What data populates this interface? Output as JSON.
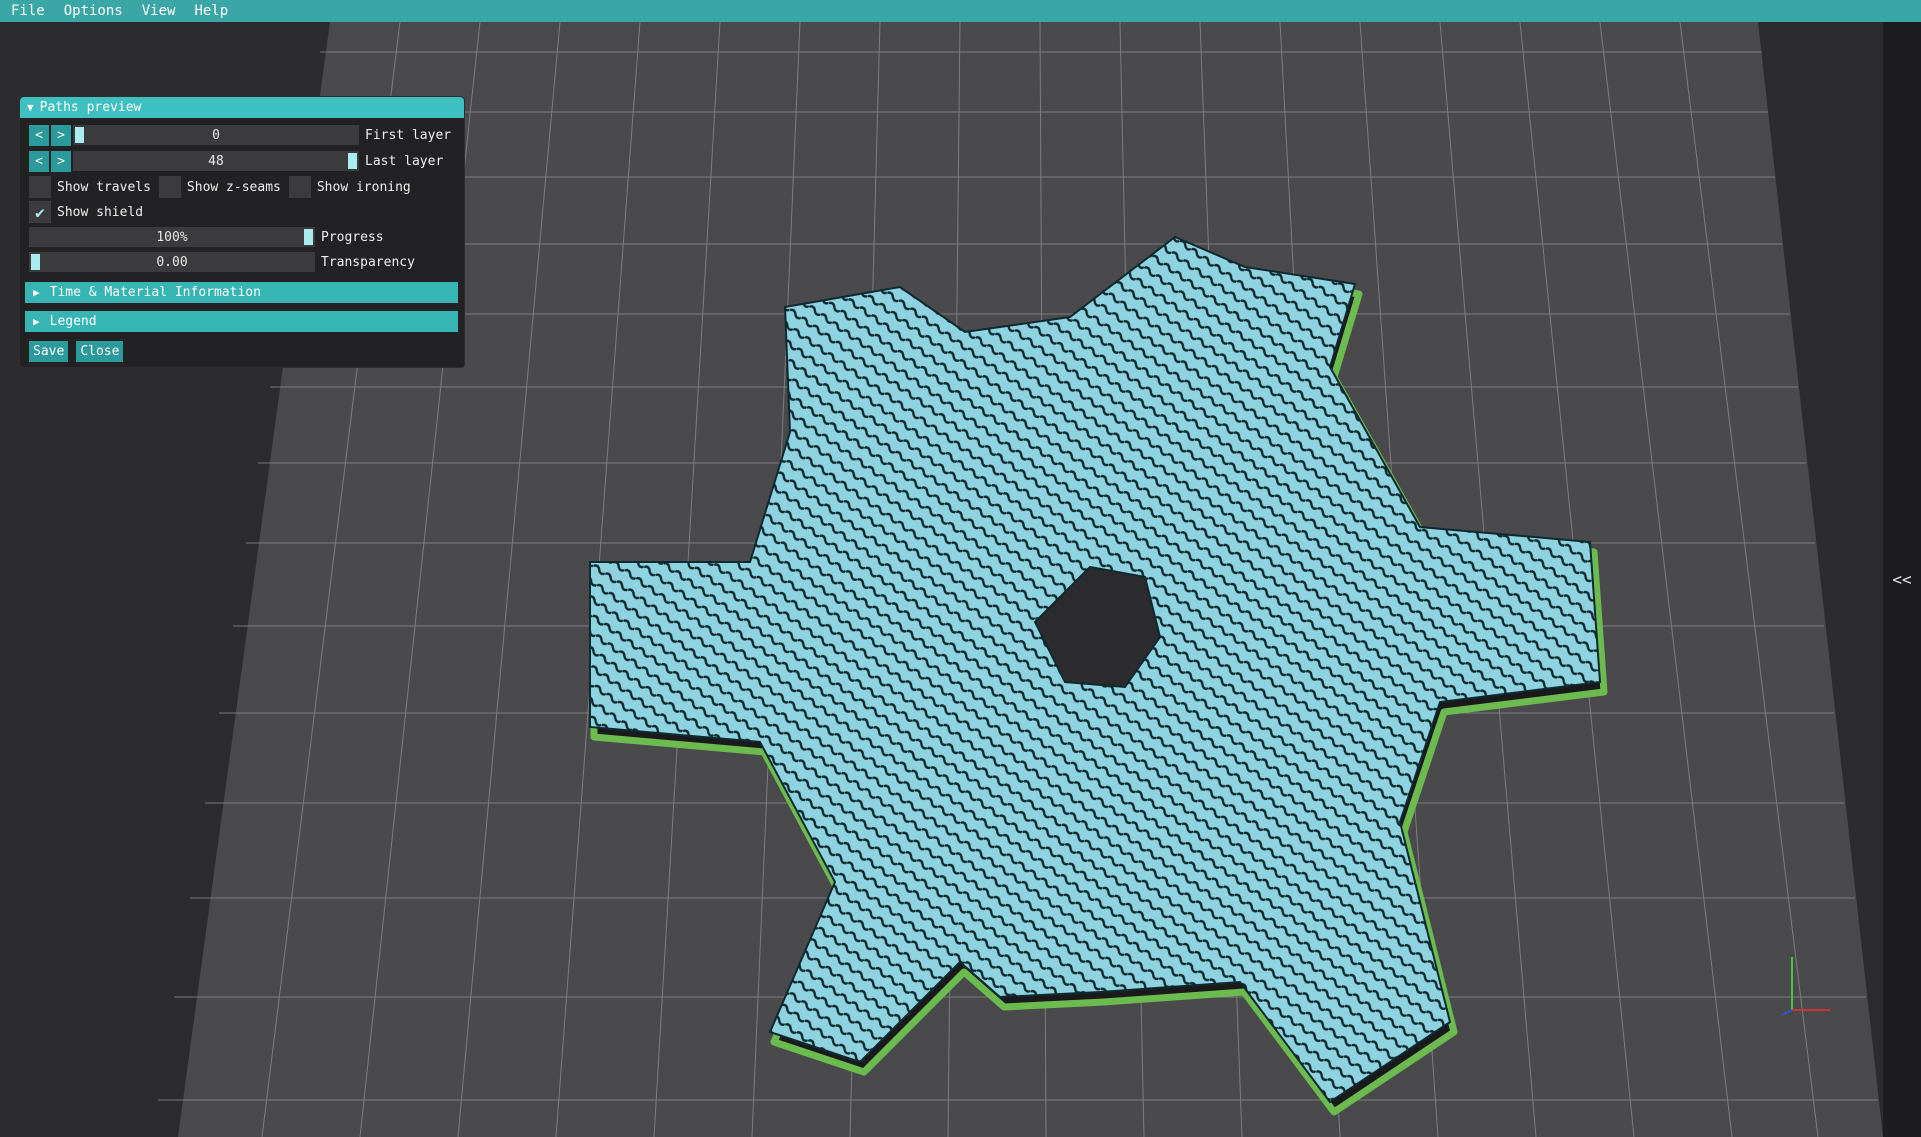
{
  "menu": [
    "File",
    "Options",
    "View",
    "Help"
  ],
  "panel": {
    "title": "Paths preview",
    "first_layer": {
      "prev": "<",
      "next": ">",
      "value": "0",
      "label": "First layer",
      "level": 0.0
    },
    "last_layer": {
      "prev": "<",
      "next": ">",
      "value": "48",
      "label": "Last layer",
      "level": 1.0
    },
    "checks": {
      "show_travels": {
        "label": "Show travels",
        "checked": false
      },
      "show_zseams": {
        "label": "Show z-seams",
        "checked": false
      },
      "show_ironing": {
        "label": "Show ironing",
        "checked": false
      },
      "show_shield": {
        "label": "Show shield",
        "checked": true
      }
    },
    "progress": {
      "value": "100%",
      "label": "Progress",
      "level": 1.0
    },
    "transparency": {
      "value": "0.00",
      "label": "Transparency",
      "level": 0.0
    },
    "sections": {
      "time_material": "Time & Material Information",
      "legend": "Legend"
    },
    "buttons": {
      "save": "Save",
      "close": "Close"
    }
  },
  "side_toggle": "<<",
  "colors": {
    "accent": "#3aa6a6",
    "background": "#2c2c2e",
    "bed": "#4a4a4c",
    "model": "#8fd3e0",
    "shield": "#6cbb4f"
  },
  "icons": {
    "collapse_open": "triangle-down-icon",
    "collapse_closed": "triangle-right-icon",
    "check": "checkmark-icon",
    "axes": "axis-gizmo-icon"
  }
}
